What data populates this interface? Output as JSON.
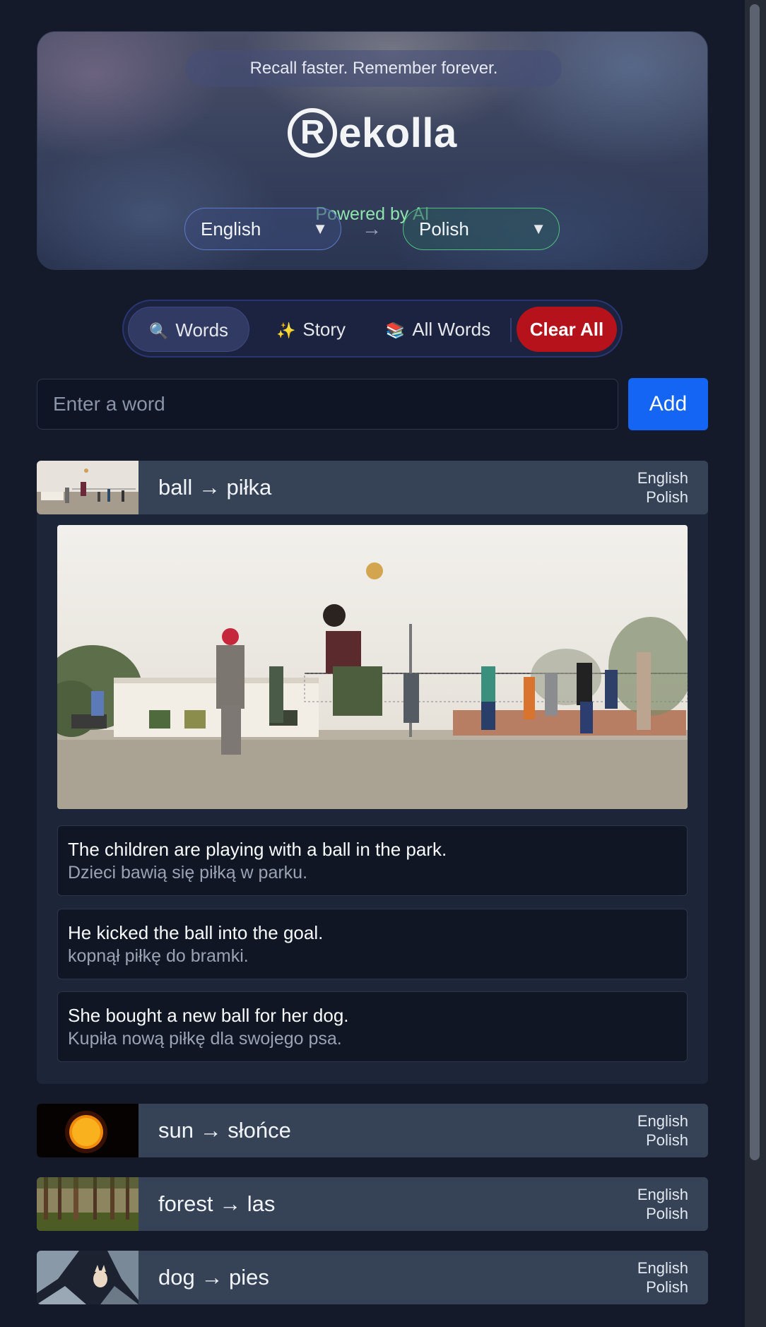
{
  "header": {
    "tagline": "Recall faster. Remember forever.",
    "logo_text": "ekolla",
    "logo_letter": "R",
    "powered_by": "Powered by AI",
    "source_language": "English",
    "target_language": "Polish",
    "caret": "▼",
    "arrow": "→"
  },
  "tabs": {
    "words": {
      "icon": "🔍",
      "label": "Words"
    },
    "story": {
      "icon": "✨",
      "label": "Story"
    },
    "all_words": {
      "icon": "📚",
      "label": "All Words"
    },
    "clear_all": "Clear All"
  },
  "input": {
    "placeholder": "Enter a word",
    "value": "",
    "add_label": "Add"
  },
  "words": [
    {
      "pair": "ball → piłka",
      "source_lang": "English",
      "target_lang": "Polish",
      "expanded": true,
      "sentences": [
        {
          "source": "The children are playing with a ball in the park.",
          "target": "Dzieci bawią się piłką w parku."
        },
        {
          "source": "He kicked the ball into the goal.",
          "target": "kopnął piłkę do bramki."
        },
        {
          "source": "She bought a new ball for her dog.",
          "target": "Kupiła nową piłkę dla swojego psa."
        }
      ]
    },
    {
      "pair": "sun → słońce",
      "source_lang": "English",
      "target_lang": "Polish"
    },
    {
      "pair": "forest → las",
      "source_lang": "English",
      "target_lang": "Polish"
    },
    {
      "pair": "dog → pies",
      "source_lang": "English",
      "target_lang": "Polish"
    }
  ],
  "colors": {
    "background": "#141a2a",
    "accent_blue": "#1565f5",
    "clear_red": "#b5121b",
    "powered_green": "#8fe3ad"
  }
}
